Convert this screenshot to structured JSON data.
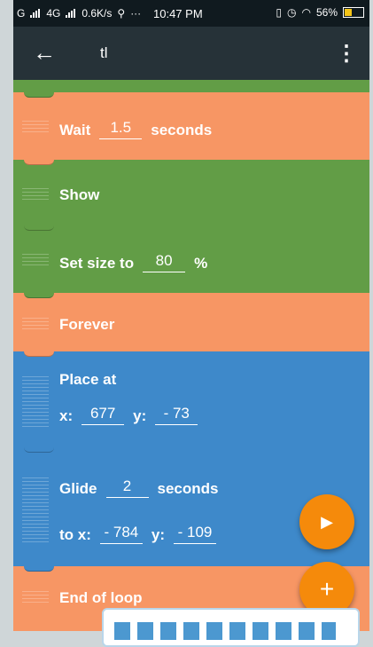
{
  "status_bar": {
    "network_label": "G",
    "network2_label": "4G",
    "speed": "0.6K/s",
    "dots": "···",
    "time": "10:47 PM",
    "battery": "56%"
  },
  "app_bar": {
    "back_icon": "arrow-left-icon",
    "title": "tl",
    "menu_icon": "more-vert-icon",
    "menu_glyph": "⋮"
  },
  "blocks": [
    {
      "type": "wait",
      "color": "#f79664",
      "label": "Wait",
      "value": "1.5",
      "suffix": "seconds"
    },
    {
      "type": "show",
      "color": "#629d46",
      "label": "Show"
    },
    {
      "type": "set-size",
      "color": "#629d46",
      "label": "Set size to",
      "value": "80",
      "suffix": "%"
    },
    {
      "type": "forever",
      "color": "#f79664",
      "label": "Forever"
    },
    {
      "type": "place-at",
      "color": "#3e89ca",
      "label": "Place at",
      "x_label": "x:",
      "x_value": "677",
      "y_label": "y:",
      "y_value": "- 73"
    },
    {
      "type": "glide",
      "color": "#3e89ca",
      "label": "Glide",
      "value": "2",
      "suffix": "seconds",
      "x_label": "to x:",
      "x_value": "- 784",
      "y_label": "y:",
      "y_value": "- 109"
    },
    {
      "type": "end-loop",
      "color": "#f79664",
      "label": "End of loop"
    }
  ],
  "fabs": {
    "play_icon": "play-icon",
    "play_glyph": "▶",
    "add_icon": "plus-icon",
    "add_glyph": "+"
  },
  "colors": {
    "orange": "#f79664",
    "green": "#629d46",
    "blue": "#3e89ca",
    "fab": "#f58a0b",
    "appbar": "#263238"
  }
}
